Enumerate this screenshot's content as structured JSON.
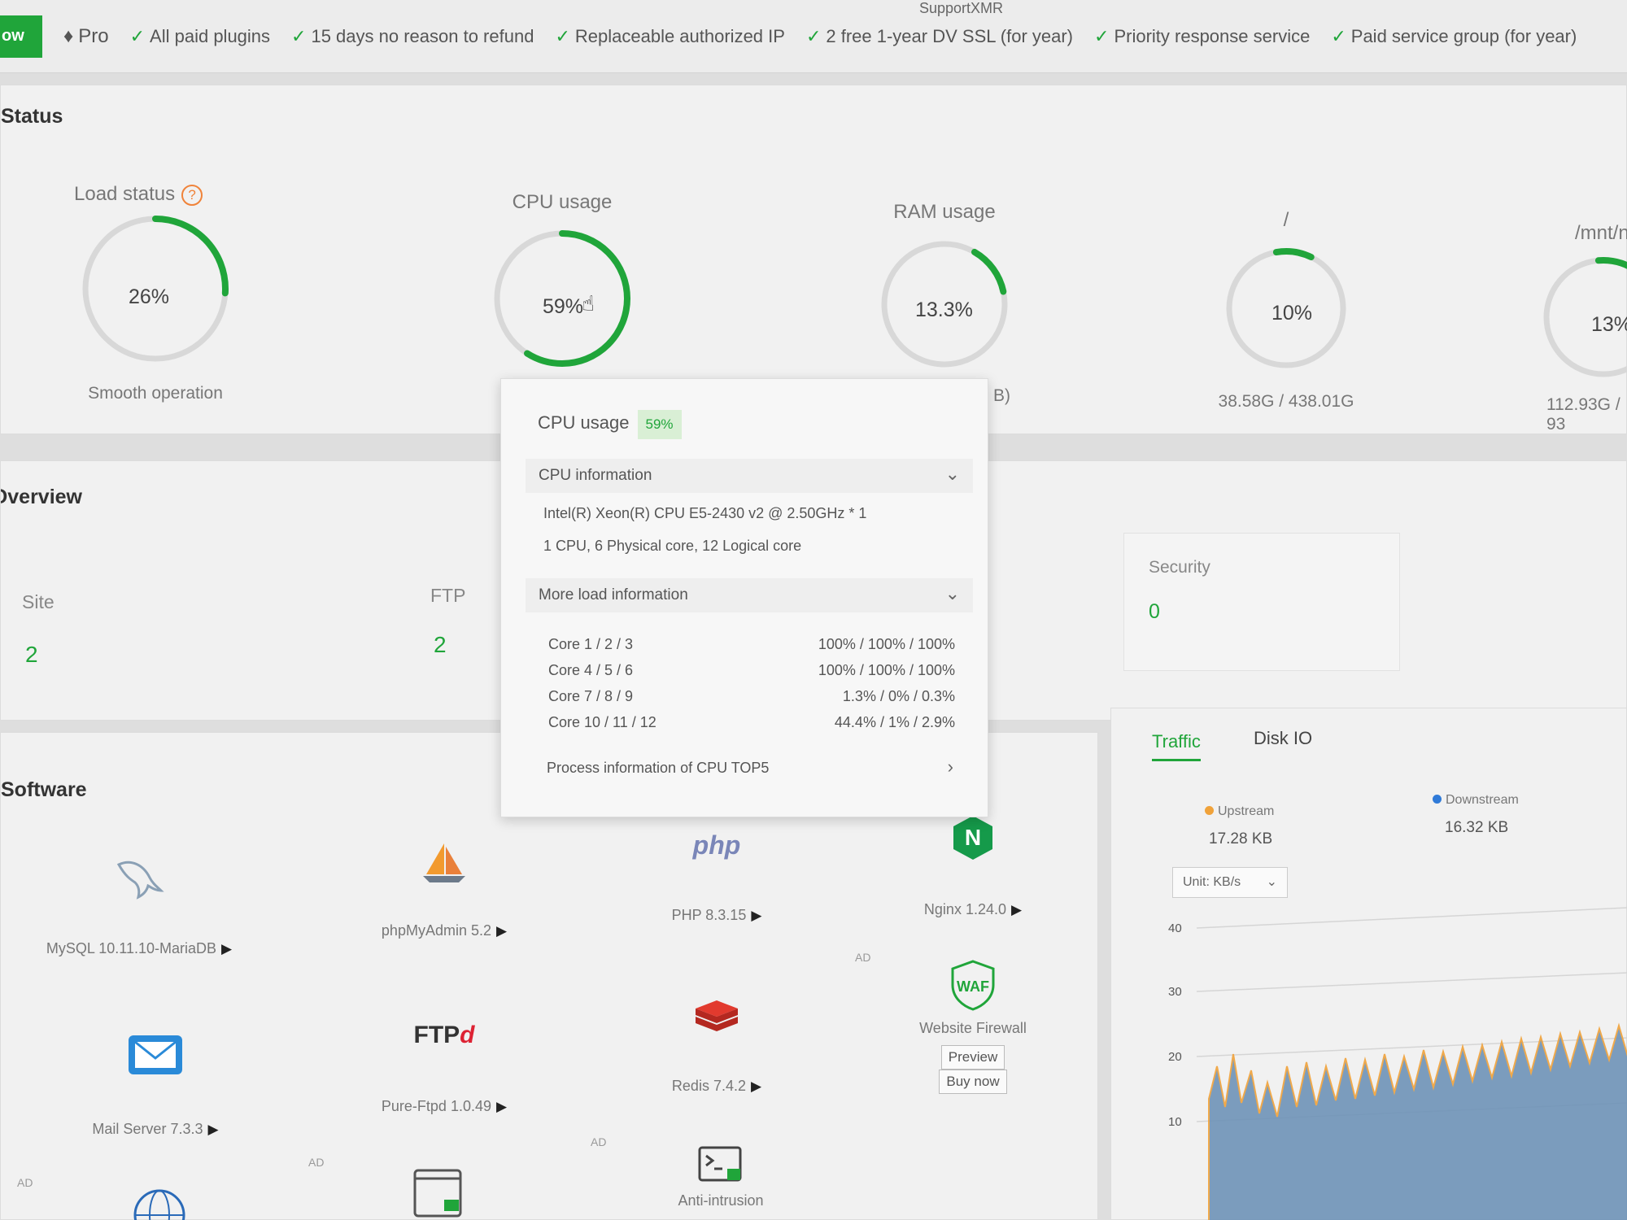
{
  "topbar": {
    "buy_label": "ow",
    "pro_label": "Pro",
    "support_label": "SupportXMR",
    "features": [
      "All paid plugins",
      "15 days no reason to refund",
      "Replaceable authorized IP",
      "2 free 1-year DV SSL (for year)",
      "Priority response service",
      "Paid service group (for year)"
    ]
  },
  "status": {
    "title": "Status",
    "gauges": [
      {
        "title": "Load status",
        "value": "26%",
        "sub": "Smooth operation",
        "level": 0.26
      },
      {
        "title": "CPU usage",
        "value": "59%",
        "sub": "",
        "level": 0.59
      },
      {
        "title": "RAM usage",
        "value": "13.3%",
        "sub": "B)",
        "level": 0.133
      },
      {
        "title": "/",
        "value": "10%",
        "sub": "38.58G / 438.01G",
        "level": 0.1
      },
      {
        "title": "/mnt/nv",
        "value": "13%",
        "sub": "112.93G / 93",
        "level": 0.13
      }
    ]
  },
  "overview": {
    "title": "Overview",
    "site_label": "Site",
    "site_value": "2",
    "ftp_label": "FTP",
    "ftp_value": "2",
    "security_label": "Security",
    "security_value": "0"
  },
  "cpu_popup": {
    "title": "CPU usage",
    "badge": "59%",
    "cpu_info_label": "CPU information",
    "cpu_model": "Intel(R) Xeon(R) CPU E5-2430 v2 @ 2.50GHz * 1",
    "cpu_cores": "1 CPU, 6 Physical core, 12 Logical core",
    "more_load_label": "More load information",
    "cores": [
      {
        "label": "Core 1 / 2 / 3",
        "value": "100% / 100% / 100%"
      },
      {
        "label": "Core 4 / 5 / 6",
        "value": "100% / 100% / 100%"
      },
      {
        "label": "Core 7 / 8 / 9",
        "value": "1.3% / 0% / 0.3%"
      },
      {
        "label": "Core 10 / 11 / 12",
        "value": "44.4% / 1% / 2.9%"
      }
    ],
    "process_label": "Process information of CPU TOP5"
  },
  "software": {
    "title": "Software",
    "items": [
      {
        "name": "MySQL 10.11.10-MariaDB",
        "icon": "dolphin-icon"
      },
      {
        "name": "phpMyAdmin 5.2",
        "icon": "sailboat-icon"
      },
      {
        "name": "PHP 8.3.15",
        "icon": "php-icon",
        "logo": "php"
      },
      {
        "name": "Nginx 1.24.0",
        "icon": "nginx-icon",
        "logo": "N"
      },
      {
        "name": "Mail Server 7.3.3",
        "icon": "mail-icon"
      },
      {
        "name": "Pure-Ftpd 1.0.49",
        "icon": "ftp-icon",
        "logo": "FTP",
        "logo_accent": "d"
      },
      {
        "name": "Redis 7.4.2",
        "icon": "redis-icon"
      },
      {
        "name": "Website Firewall",
        "icon": "waf-icon",
        "logo": "WAF"
      },
      {
        "name": "Anti-intrusion",
        "icon": "terminal-lock-icon"
      }
    ],
    "ad_label": "AD",
    "preview_label": "Preview",
    "buynow_label": "Buy now"
  },
  "traffic": {
    "tabs": [
      "Traffic",
      "Disk IO"
    ],
    "upstream_label": "Upstream",
    "upstream_value": "17.28 KB",
    "downstream_label": "Downstream",
    "downstream_value": "16.32 KB",
    "unit_label": "Unit: KB/s",
    "y_ticks": [
      "40",
      "30",
      "20",
      "10"
    ],
    "colors": {
      "upstream": "#f0a23a",
      "downstream": "#2f7ad8",
      "accent": "#20a53a"
    }
  }
}
